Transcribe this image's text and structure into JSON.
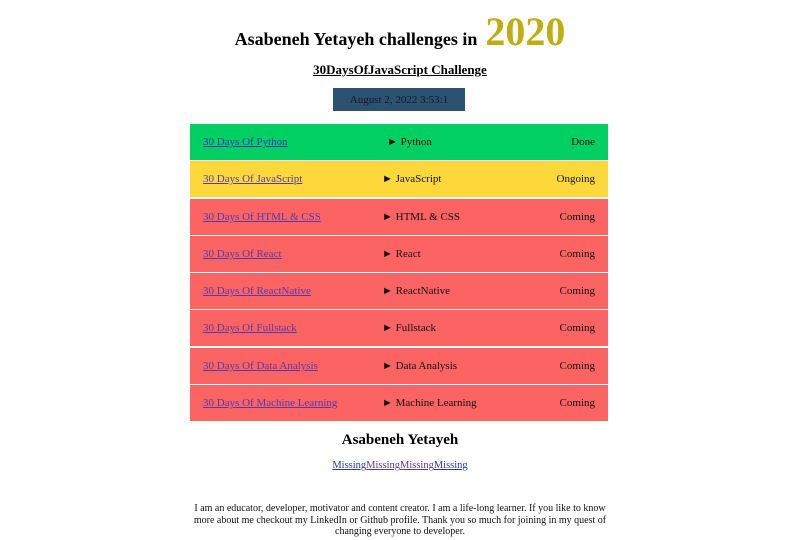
{
  "header": {
    "title": "Asabeneh Yetayeh challenges in",
    "year": "2020",
    "year_color": "#c0ad12"
  },
  "subtitle": "30DaysOfJavaScript Challenge",
  "datetime": "August 2, 2022 3:53:1",
  "challenges": [
    {
      "name": "30 Days Of Python",
      "topic": "Python",
      "status": "Done",
      "color": "#00d062"
    },
    {
      "name": "30 Days Of JavaScript",
      "topic": "JavaScript",
      "status": "Ongoing",
      "color": "#fcd83b"
    },
    {
      "name": "30 Days Of HTML & CSS",
      "topic": "HTML & CSS",
      "status": "Coming",
      "color": "#fc6363"
    },
    {
      "name": "30 Days Of React",
      "topic": "React",
      "status": "Coming",
      "color": "#fc6363"
    },
    {
      "name": "30 Days Of ReactNative",
      "topic": "ReactNative",
      "status": "Coming",
      "color": "#fc6363"
    },
    {
      "name": "30 Days Of Fullstack",
      "topic": "Fullstack",
      "status": "Coming",
      "color": "#fc6363"
    },
    {
      "name": "30 Days Of Data Analysis",
      "topic": "Data Analysis",
      "status": "Coming",
      "color": "#fc6363"
    },
    {
      "name": "30 Days Of Machine Learning",
      "topic": "Machine Learning",
      "status": "Coming",
      "color": "#fc6363"
    }
  ],
  "topic_marker": "►",
  "author": {
    "name": "Asabeneh Yetayeh",
    "links": [
      "Missing",
      "Missing",
      "Missing",
      "Missing"
    ],
    "bio": "I am an educator, developer, motivator and content creator. I am a life-long learner. If you like to know more about me checkout my LinkedIn or Github profile. Thank you so much for joining in my quest of changing everyone to developer."
  }
}
